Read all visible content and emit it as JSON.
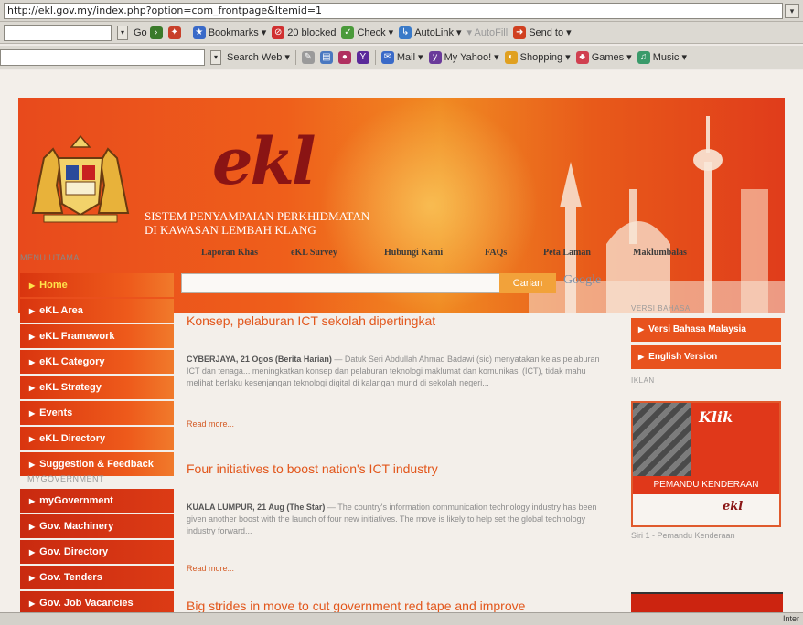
{
  "browser": {
    "address_url": "http://ekl.gov.my/index.php?option=com_frontpage&Itemid=1",
    "toolbar1": {
      "go": "Go",
      "bookmarks": "Bookmarks",
      "blocked": "20 blocked",
      "check": "Check",
      "autolink": "AutoLink",
      "send_to": "Send to"
    },
    "toolbar2": {
      "search_web": "Search Web",
      "mail": "Mail",
      "my_yahoo": "My Yahoo!",
      "shopping": "Shopping",
      "games": "Games",
      "music": "Music"
    },
    "status_zone": "Inter"
  },
  "banner": {
    "logo": "ekl",
    "title_line1": "SISTEM PENYAMPAIAN PERKHIDMATAN",
    "title_line2": "DI KAWASAN LEMBAH KLANG"
  },
  "topnav": {
    "menu_label": "MENU UTAMA",
    "links": [
      "Laporan Khas",
      "eKL Survey",
      "Hubungi Kami",
      "FAQs",
      "Peta Laman",
      "Maklumbalas"
    ]
  },
  "left_menu": {
    "items": [
      "Home",
      "eKL Area",
      "eKL Framework",
      "eKL Category",
      "eKL Strategy",
      "Events",
      "eKL Directory",
      "Suggestion & Feedback"
    ],
    "section_label": "MYGOVERNMENT",
    "gov_items": [
      "myGovernment",
      "Gov. Machinery",
      "Gov. Directory",
      "Gov. Tenders",
      "Gov. Job Vacancies"
    ]
  },
  "search": {
    "button": "Carian",
    "google": "Google"
  },
  "news": [
    {
      "title": "Konsep, pelaburan ICT sekolah dipertingkat",
      "lead": "CYBERJAYA, 21 Ogos (Berita Harian)",
      "body": "— Datuk Seri Abdullah Ahmad Badawi (sic) menyatakan kelas pelaburan ICT dan tenaga... meningkatkan konsep dan pelaburan teknologi maklumat dan komunikasi (ICT), tidak mahu melihat berlaku kesenjangan teknologi digital di kalangan murid di sekolah negeri...",
      "read_more": "Read more..."
    },
    {
      "title": "Four initiatives to boost nation's ICT industry",
      "lead": "KUALA LUMPUR, 21 Aug (The Star)",
      "body": "— The country's information communication technology industry has been given another boost with the launch of four new initiatives. The move is likely to help set the global technology industry forward...",
      "read_more": "Read more..."
    },
    {
      "title": "Big strides in move to cut government red tape and improve"
    }
  ],
  "right_col": {
    "label1": "VERSI BAHASA",
    "btn_malay": "Versi Bahasa Malaysia",
    "btn_english": "English Version",
    "label2": "IKLAN",
    "ad_brand": "Klik",
    "ad_sub": "PEMANDU KENDERAAN",
    "ad_logo": "ekl",
    "ad_caption": "Siri 1 - Pemandu Kenderaan"
  },
  "colors": {
    "accent_orange": "#e8521d",
    "menu_red": "#d9350f",
    "headline": "#e2561b"
  }
}
